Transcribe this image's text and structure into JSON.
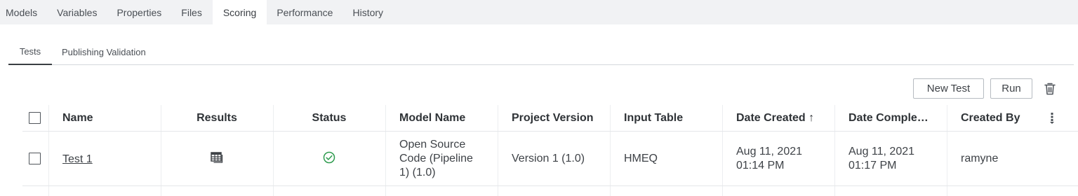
{
  "top_tabs": [
    {
      "label": "Models"
    },
    {
      "label": "Variables"
    },
    {
      "label": "Properties"
    },
    {
      "label": "Files"
    },
    {
      "label": "Scoring",
      "active": true
    },
    {
      "label": "Performance"
    },
    {
      "label": "History"
    }
  ],
  "sub_tabs": [
    {
      "label": "Tests",
      "active": true
    },
    {
      "label": "Publishing Validation"
    }
  ],
  "toolbar": {
    "new_test_label": "New Test",
    "run_label": "Run",
    "delete_icon": "trash-icon"
  },
  "table": {
    "columns": [
      "Name",
      "Results",
      "Status",
      "Model Name",
      "Project Version",
      "Input Table",
      "Date Created ↑",
      "Date Comple…",
      "Created By"
    ],
    "column_options_icon": "column-options-icon",
    "rows": [
      {
        "name": "Test 1",
        "results_icon": "table-results-icon",
        "status_icon": "check-circle-icon",
        "status_color": "#2e9b4e",
        "model_name_lines": [
          "Open Source",
          "Code (Pipeline",
          "1) (1.0)"
        ],
        "project_version": "Version 1 (1.0)",
        "input_table": "HMEQ",
        "date_created_lines": [
          "Aug 11, 2021",
          "01:14 PM"
        ],
        "date_completed_lines": [
          "Aug 11, 2021",
          "01:17 PM"
        ],
        "created_by": "ramyne"
      }
    ]
  }
}
